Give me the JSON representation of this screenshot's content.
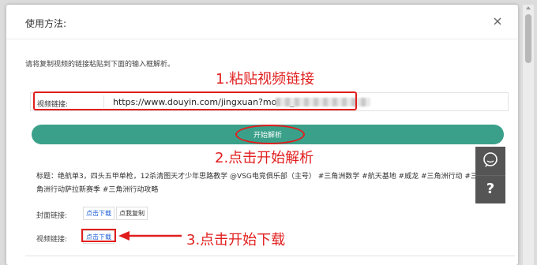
{
  "modal": {
    "title": "使用方法:",
    "instruction": "请将复制视频的链接粘贴到下面的输入框解析。"
  },
  "input": {
    "label": "视频链接:",
    "value": "https://www.douyin.com/jingxuan?modal_id="
  },
  "parse_button": {
    "label": "开始解析"
  },
  "annotations": {
    "step1": "1.粘贴视频链接",
    "step2": "2.点击开始解析",
    "step3": "3.点击开始下载"
  },
  "result": {
    "title_text": "标题：绝航单3，四头五甲单枪，12杀清图天才少年思路教学 @VSG电竞俱乐部（主号） #三角洲数学 #航天基地 #威龙 #三角洲行动 #三角洲行动萨拉新赛季 #三角洲行动攻略",
    "cover_label": "封面链接:",
    "cover_download": "点击下载",
    "cover_copy": "点我复制",
    "video_label": "视频链接:",
    "video_download": "点击下载"
  },
  "side_buttons": {
    "chat_icon": "chat-bubble-icon",
    "help_icon": "question-icon",
    "help_glyph": "?"
  },
  "colors": {
    "accent": "#3aa08a",
    "annotation_red": "#e11e1e",
    "link_blue": "#1c5fd6",
    "side_button_bg": "#555555"
  }
}
